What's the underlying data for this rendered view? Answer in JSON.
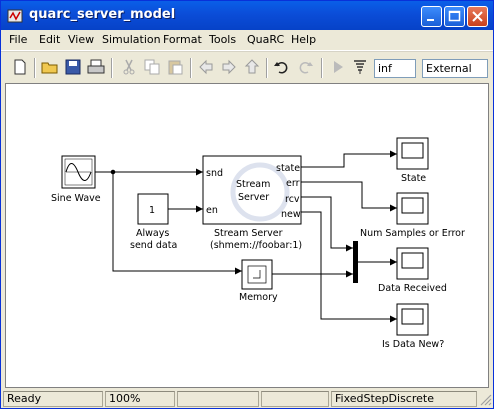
{
  "window": {
    "title": "quarc_server_model"
  },
  "menu": [
    "File",
    "Edit",
    "View",
    "Simulation",
    "Format",
    "Tools",
    "QuaRC",
    "Help"
  ],
  "toolbar": {
    "stop_time": "inf",
    "mode": "External"
  },
  "blocks": {
    "sine_wave": "Sine Wave",
    "always_const": "1",
    "always_label_1": "Always",
    "always_label_2": "send data",
    "server_inner_1": "Stream",
    "server_inner_2": "Server",
    "server_label_1": "Stream Server",
    "server_label_2": "(shmem://foobar:1)",
    "port_snd": "snd",
    "port_en": "en",
    "port_state": "state",
    "port_err": "err",
    "port_rcv": "rcv",
    "port_new": "new",
    "memory": "Memory",
    "scope_state": "State",
    "scope_num": "Num Samples or Error",
    "scope_data": "Data Received",
    "scope_new": "Is Data New?"
  },
  "status": {
    "ready": "Ready",
    "zoom": "100%",
    "solver": "FixedStepDiscrete"
  },
  "icons": [
    "new-icon",
    "open-icon",
    "save-icon",
    "print-icon",
    "cut-icon",
    "copy-icon",
    "paste-icon",
    "back-icon",
    "forward-icon",
    "up-icon",
    "undo-icon",
    "redo-icon",
    "play-icon",
    "build-icon"
  ]
}
